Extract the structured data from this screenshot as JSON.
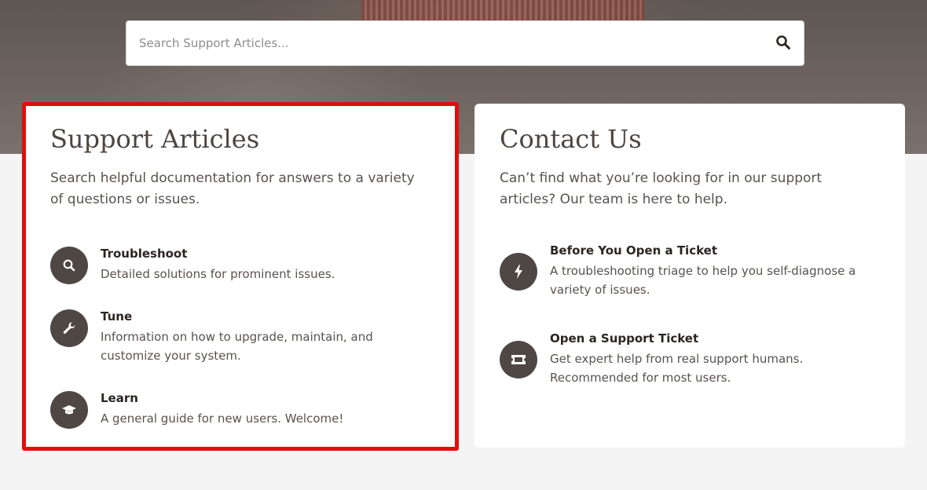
{
  "search": {
    "placeholder": "Search Support Articles..."
  },
  "support_articles": {
    "title": "Support Articles",
    "description": "Search helpful documentation for answers to a variety of questions or issues.",
    "items": [
      {
        "title": "Troubleshoot",
        "description": "Detailed solutions for prominent issues.",
        "icon": "search-icon"
      },
      {
        "title": "Tune",
        "description": "Information on how to upgrade, maintain, and customize your system.",
        "icon": "wrench-icon"
      },
      {
        "title": "Learn",
        "description": "A general guide for new users. Welcome!",
        "icon": "graduation-cap-icon"
      }
    ]
  },
  "contact_us": {
    "title": "Contact Us",
    "description": "Can’t find what you’re looking for in our support articles? Our team is here to help.",
    "items": [
      {
        "title": "Before You Open a Ticket",
        "description": "A troubleshooting triage to help you self-diagnose a variety of issues.",
        "icon": "lightning-bolt-icon"
      },
      {
        "title": "Open a Support Ticket",
        "description": "Get expert help from real support humans. Recommended for most users.",
        "icon": "ticket-icon"
      }
    ]
  },
  "colors": {
    "icon_circle": "#4f4743",
    "highlight_border": "#e00d0d",
    "hero_background": "#6a625e"
  }
}
